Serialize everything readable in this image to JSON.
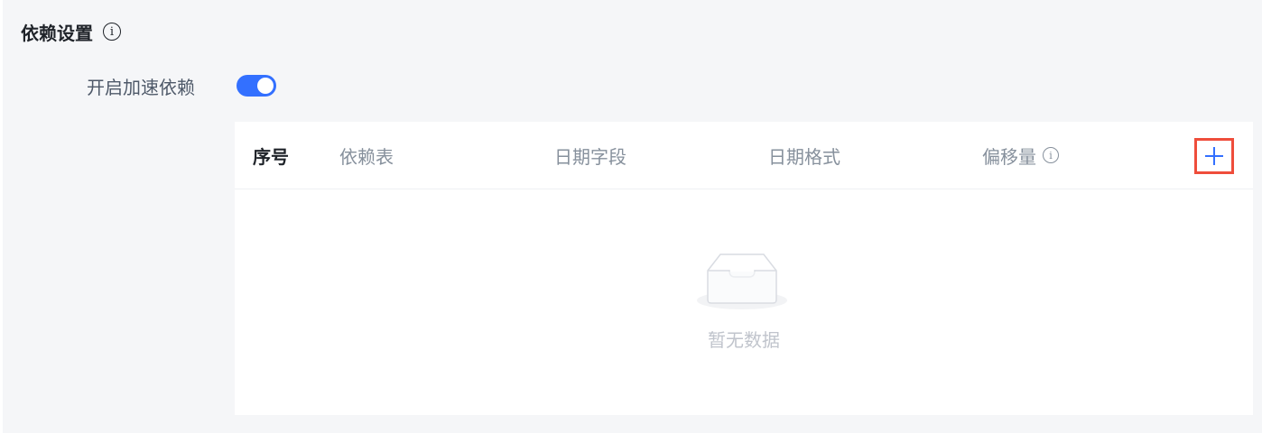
{
  "section": {
    "title": "依赖设置",
    "info_icon": "info-circle-icon"
  },
  "accelerate": {
    "label": "开启加速依赖",
    "enabled": true
  },
  "table": {
    "columns": [
      "序号",
      "依赖表",
      "日期字段",
      "日期格式",
      "偏移量"
    ],
    "offset_info_icon": "info-circle-icon",
    "add_icon": "plus-icon",
    "empty_icon": "empty-inbox-icon",
    "empty_text": "暂无数据",
    "rows": []
  },
  "colors": {
    "accent": "#3370ff",
    "highlight_border": "#ef4d3b",
    "panel_bg": "#f5f6f8"
  }
}
